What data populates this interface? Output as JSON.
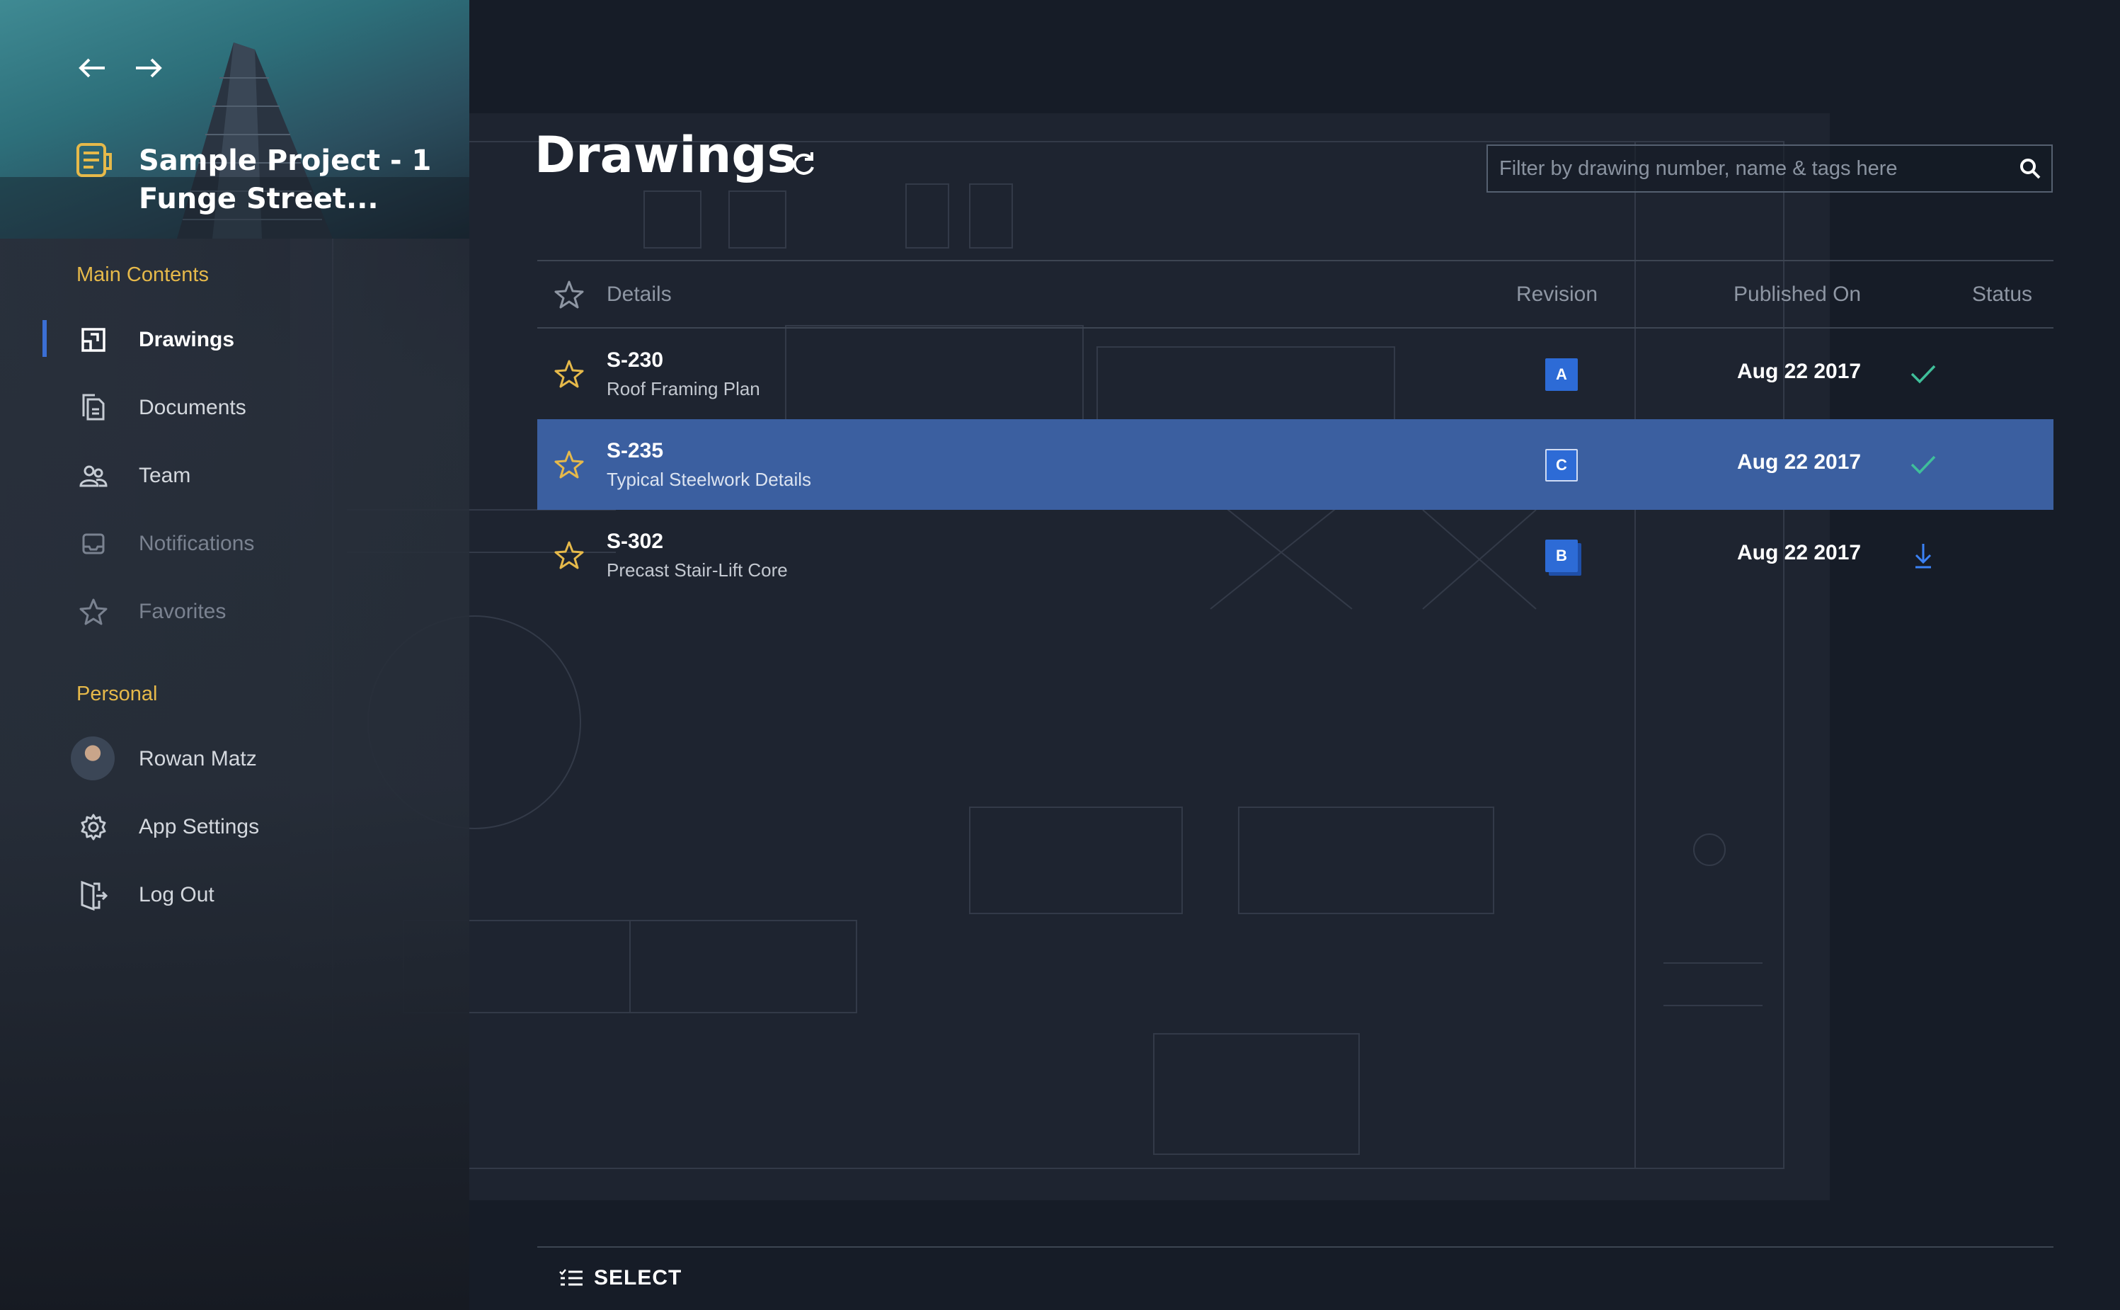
{
  "sidebar": {
    "project_title": "Sample Project - 1 Funge Street...",
    "main_contents_label": "Main Contents",
    "personal_label": "Personal",
    "items": {
      "drawings": "Drawings",
      "documents": "Documents",
      "team": "Team",
      "notifications": "Notifications",
      "favorites": "Favorites",
      "user": "Rowan Matz",
      "settings": "App Settings",
      "logout": "Log Out"
    }
  },
  "main": {
    "title": "Drawings",
    "search_placeholder": "Filter by drawing number, name & tags here",
    "columns": {
      "details": "Details",
      "revision": "Revision",
      "published_on": "Published On",
      "status": "Status"
    },
    "rows": [
      {
        "number": "S-230",
        "name": "Roof Framing Plan",
        "revision": "A",
        "published": "Aug 22 2017",
        "status": "check-icon"
      },
      {
        "number": "S-235",
        "name": "Typical Steelwork Details",
        "revision": "C",
        "published": "Aug 22 2017",
        "status": "check-icon"
      },
      {
        "number": "S-302",
        "name": "Precast Stair-Lift Core",
        "revision": "B",
        "published": "Aug 22 2017",
        "status": "download-icon"
      }
    ],
    "select_label": "SELECT"
  },
  "colors": {
    "accent": "#e6b94a",
    "selected_row": "#3b5fa0",
    "revision_badge": "#2d6bd6",
    "status_check": "#3fbf9a",
    "status_download": "#3b82f6",
    "active_bar": "#3b6fd4"
  }
}
